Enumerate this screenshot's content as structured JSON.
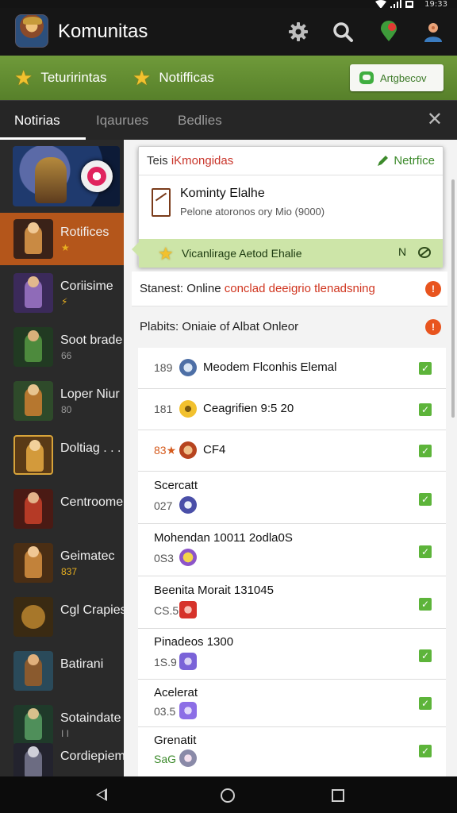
{
  "status_bar": {
    "time": "19:33"
  },
  "app_bar": {
    "title": "Komunitas"
  },
  "green_tabs": [
    {
      "label": "Teturirintas"
    },
    {
      "label": "Notifficas"
    }
  ],
  "green_button": {
    "label": "Artgbecov"
  },
  "dark_tabs": [
    {
      "label": "Notirias"
    },
    {
      "label": "Iqaurues"
    },
    {
      "label": "Bedlies"
    }
  ],
  "sidebar": {
    "items": [
      {
        "label": "Rotifices",
        "sub": "★"
      },
      {
        "label": "Coriisime",
        "sub": "⚡"
      },
      {
        "label": "Soot brade",
        "sub": "66"
      },
      {
        "label": "Loper Niur",
        "sub": "80"
      },
      {
        "label": "Doltiag . . .",
        "sub": ""
      },
      {
        "label": "Centroome",
        "sub": ""
      },
      {
        "label": "Geimatec",
        "sub": "837"
      },
      {
        "label": "Cgl Crapies",
        "sub": ""
      },
      {
        "label": "Batirani",
        "sub": ""
      },
      {
        "label": "Sotaindate",
        "sub": "I I"
      },
      {
        "label": "Cordiepiem",
        "sub": ""
      }
    ]
  },
  "popup": {
    "header_left_prefix": "Teis ",
    "header_left_red": "iKmongidas",
    "header_right": "Netrfice",
    "title": "Kominty Elalhe",
    "subtitle": "Pelone atoronos ory Mio (9000)",
    "green_label": "Vicanlirage Aetod Ehalie",
    "green_right": "N"
  },
  "status_rows": [
    {
      "text": "Stanest: Online ",
      "red": "conclad deeigrio tlenadsning",
      "alert": "!"
    },
    {
      "text": "Plabits: Oniaie of Albat Onleor",
      "red": "",
      "alert": "!"
    }
  ],
  "list_rows": [
    {
      "num": "189",
      "title": "Meodem Flconhis Elemal",
      "layout": "inline"
    },
    {
      "num": "181",
      "title": "Ceagrifien 9:5 20",
      "layout": "inline"
    },
    {
      "num": "83★",
      "title": "CF4",
      "layout": "inline"
    },
    {
      "num": "027",
      "title": "Scercatt",
      "layout": "stacked"
    },
    {
      "num": "0S3",
      "title": "Mohendan 10011 2odla0S",
      "layout": "stacked"
    },
    {
      "num": "CS.5",
      "title": "Beenita Morait 131045",
      "layout": "stacked"
    },
    {
      "num": "1S.9",
      "title": "Pinadeos 1300",
      "layout": "stacked"
    },
    {
      "num": "03.5",
      "title": "Acelerat",
      "layout": "stacked"
    },
    {
      "num": "SaG",
      "title": "Grenatit",
      "layout": "stacked"
    }
  ],
  "icons": [
    "settings-icon",
    "search-icon",
    "location-pin-icon",
    "profile-icon",
    "star-icon",
    "chat-icon",
    "close-icon",
    "check-icon",
    "alert-icon"
  ]
}
